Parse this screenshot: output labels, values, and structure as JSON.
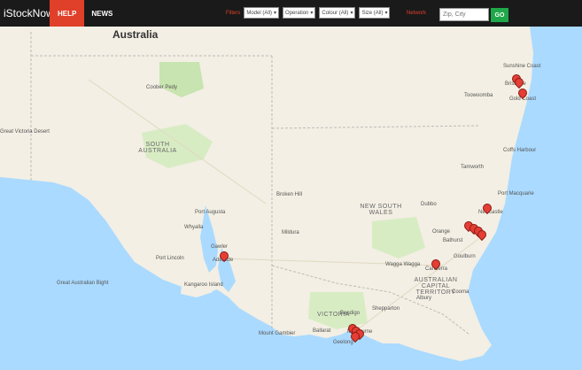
{
  "header": {
    "logo": "iStockNow",
    "help": "HELP",
    "news": "NEWS",
    "filters": [
      {
        "label": "Filters",
        "value": "Model (All)"
      },
      {
        "label": "",
        "value": "Operation"
      },
      {
        "label": "",
        "value": "Colour (All)"
      },
      {
        "label": "",
        "value": "Size (All)"
      }
    ],
    "network": "Network",
    "search_placeholder": "Zip, City",
    "go": "GO"
  },
  "map": {
    "country": "Australia",
    "states": [
      "SOUTH AUSTRALIA",
      "NEW SOUTH WALES",
      "AUSTRALIAN CAPITAL TERRITORY",
      "VICTORIA"
    ],
    "places": [
      "Adelaide",
      "Canberra",
      "Newcastle",
      "Brisbane",
      "Gold Coast",
      "Melbourne",
      "Geelong",
      "Ballarat",
      "Port Augusta",
      "Coober Pedy",
      "Mildura",
      "Wagga Wagga",
      "Bendigo",
      "Dubbo",
      "Tamworth",
      "Port Macquarie",
      "Coffs Harbour",
      "Toowoomba",
      "Sunshine Coast",
      "Broken Hill",
      "Port Lincoln",
      "Whyalla",
      "Kangaroo Island",
      "Great Australian Bight",
      "Great Victoria Desert",
      "Albury",
      "Orange",
      "Bathurst",
      "Shepparton",
      "Mount Gambier",
      "Gawler",
      "Cooma",
      "Goulburn"
    ]
  }
}
